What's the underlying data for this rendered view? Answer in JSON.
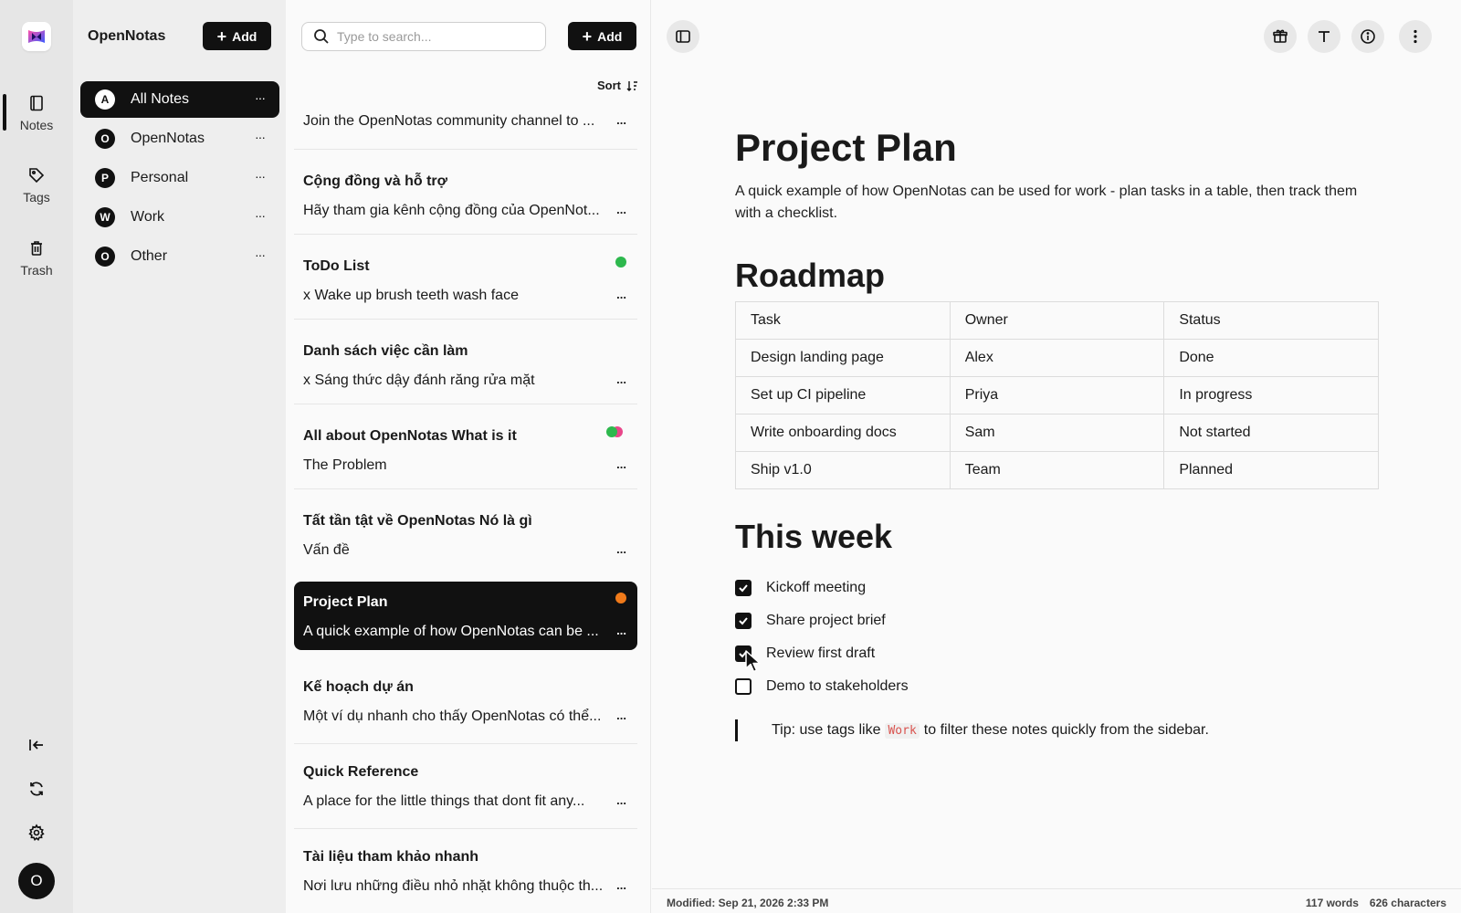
{
  "rail": {
    "nav": [
      {
        "label": "Notes",
        "icon": "notebook-icon"
      },
      {
        "label": "Tags",
        "icon": "tag-icon"
      },
      {
        "label": "Trash",
        "icon": "trash-icon"
      }
    ],
    "avatar_letter": "O"
  },
  "notebooks": {
    "title": "OpenNotas",
    "add_label": "Add",
    "items": [
      {
        "initial": "A",
        "name": "All Notes",
        "active": true
      },
      {
        "initial": "O",
        "name": "OpenNotas"
      },
      {
        "initial": "P",
        "name": "Personal"
      },
      {
        "initial": "W",
        "name": "Work"
      },
      {
        "initial": "O",
        "name": "Other"
      }
    ],
    "more": "···"
  },
  "notes": {
    "search_placeholder": "Type to search...",
    "add_label": "Add",
    "sort_label": "Sort",
    "more": "...",
    "first_preview": "Join the OpenNotas community channel to ...",
    "items": [
      {
        "title": "Cộng đồng và hỗ trợ",
        "preview": "Hãy tham gia kênh cộng đồng của OpenNot..."
      },
      {
        "title": "ToDo List",
        "preview": "x Wake up brush teeth wash face",
        "dot": "#2db84d"
      },
      {
        "title": "Danh sách việc cần làm",
        "preview": "x Sáng thức dậy đánh răng rửa mặt"
      },
      {
        "title": "All about OpenNotas What is it",
        "preview": "The Problem",
        "dots": [
          "#2db84d",
          "#e8468a"
        ]
      },
      {
        "title": "Tất tần tật về OpenNotas Nó là gì",
        "preview": "Vấn đề"
      },
      {
        "title": "Project Plan",
        "preview": "A quick example of how OpenNotas can be ...",
        "dot": "#f07a1a",
        "active": true
      },
      {
        "title": "Kế hoạch dự án",
        "preview": "Một ví dụ nhanh cho thấy OpenNotas có thể..."
      },
      {
        "title": "Quick Reference",
        "preview": "A place for the little things that dont fit any..."
      },
      {
        "title": "Tài liệu tham khảo nhanh",
        "preview": "Nơi lưu những điều nhỏ nhặt không thuộc th..."
      }
    ]
  },
  "editor": {
    "title": "Project Plan",
    "intro": "A quick example of how OpenNotas can be used for work - plan tasks in a table, then track them with a checklist.",
    "roadmap_heading": "Roadmap",
    "table": [
      [
        "Task",
        "Owner",
        "Status"
      ],
      [
        "Design landing page",
        "Alex",
        "Done"
      ],
      [
        "Set up CI pipeline",
        "Priya",
        "In progress"
      ],
      [
        "Write onboarding docs",
        "Sam",
        "Not started"
      ],
      [
        "Ship v1.0",
        "Team",
        "Planned"
      ]
    ],
    "week_heading": "This week",
    "checklist": [
      {
        "label": "Kickoff meeting",
        "checked": true
      },
      {
        "label": "Share project brief",
        "checked": true
      },
      {
        "label": "Review first draft",
        "checked": true
      },
      {
        "label": "Demo to stakeholders",
        "checked": false
      }
    ],
    "tip_before": "Tip: use tags like",
    "tip_code": "Work",
    "tip_after": "to filter these notes quickly from the sidebar."
  },
  "footer": {
    "modified": "Modified: Sep 21, 2026 2:33 PM",
    "words": "117 words",
    "characters": "626 characters"
  }
}
